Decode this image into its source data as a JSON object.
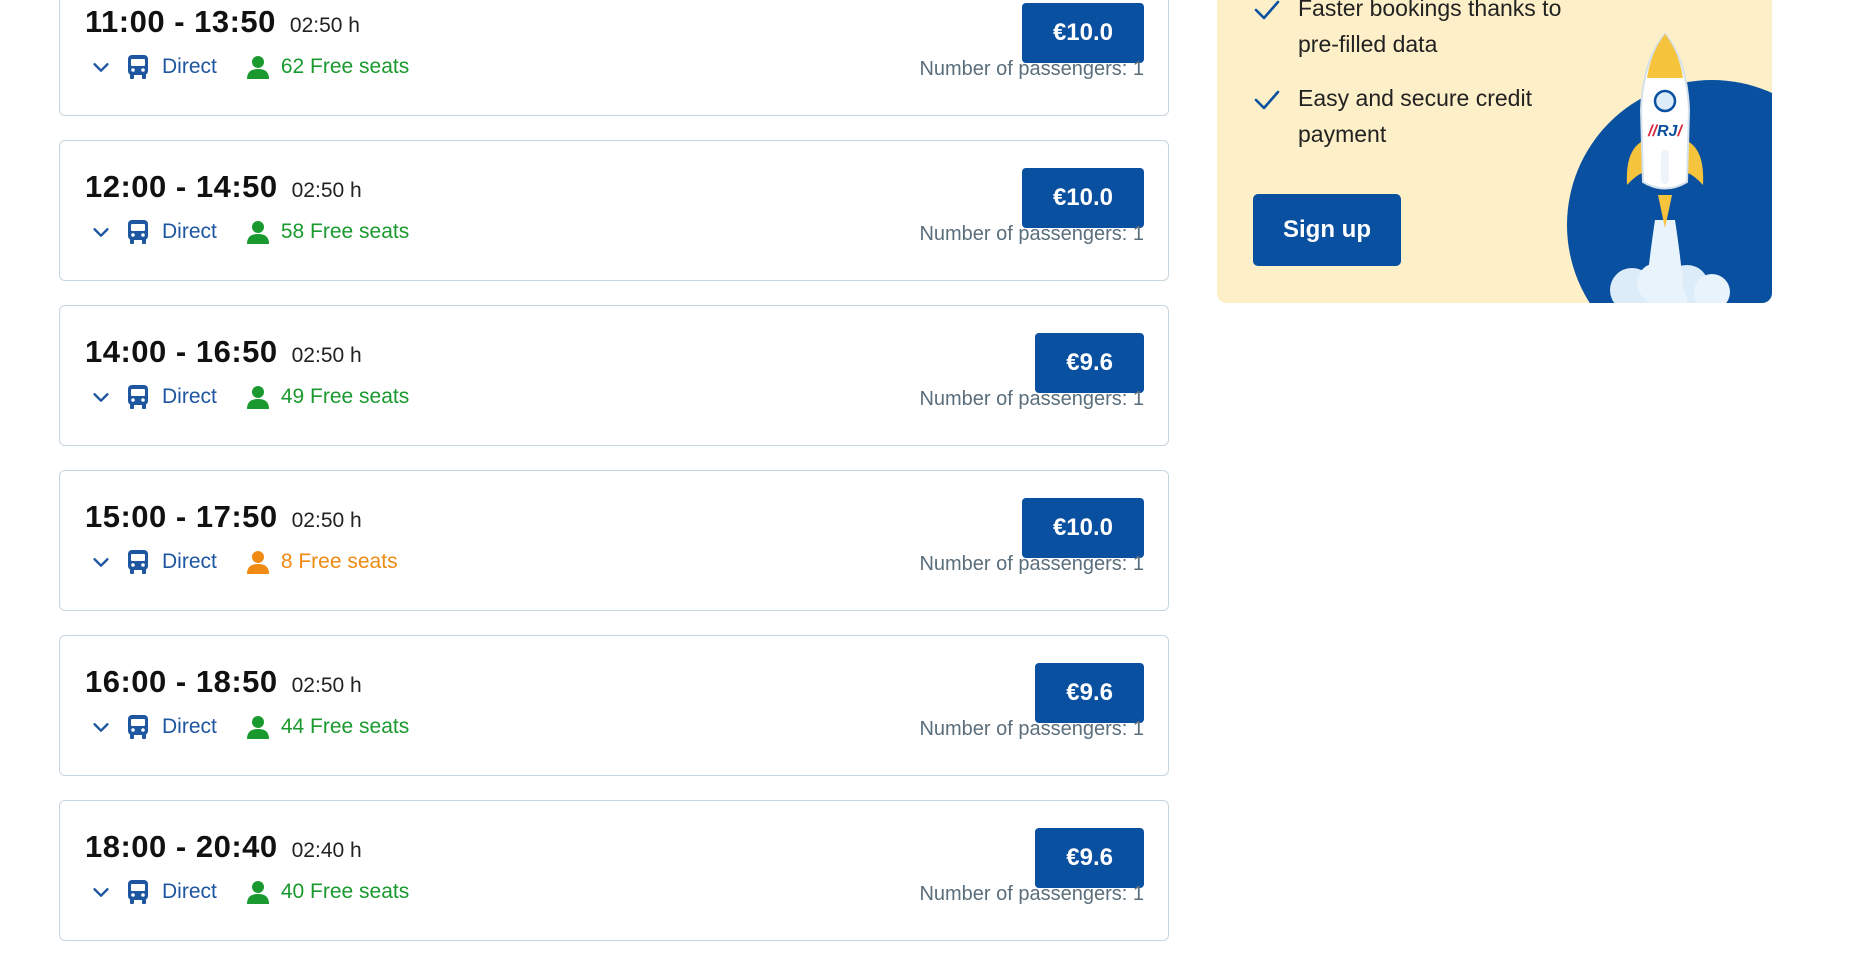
{
  "connections": [
    {
      "time": "11:00 - 13:50",
      "duration": "02:50 h",
      "type": "Direct",
      "seats": "62 Free seats",
      "seat_status": "green",
      "price": "€10.0",
      "passengers": "Number of passengers: 1"
    },
    {
      "time": "12:00 - 14:50",
      "duration": "02:50 h",
      "type": "Direct",
      "seats": "58 Free seats",
      "seat_status": "green",
      "price": "€10.0",
      "passengers": "Number of passengers: 1"
    },
    {
      "time": "14:00 - 16:50",
      "duration": "02:50 h",
      "type": "Direct",
      "seats": "49 Free seats",
      "seat_status": "green",
      "price": "€9.6",
      "passengers": "Number of passengers: 1"
    },
    {
      "time": "15:00 - 17:50",
      "duration": "02:50 h",
      "type": "Direct",
      "seats": "8 Free seats",
      "seat_status": "orange",
      "price": "€10.0",
      "passengers": "Number of passengers: 1"
    },
    {
      "time": "16:00 - 18:50",
      "duration": "02:50 h",
      "type": "Direct",
      "seats": "44 Free seats",
      "seat_status": "green",
      "price": "€9.6",
      "passengers": "Number of passengers: 1"
    },
    {
      "time": "18:00 - 20:40",
      "duration": "02:40 h",
      "type": "Direct",
      "seats": "40 Free seats",
      "seat_status": "green",
      "price": "€9.6",
      "passengers": "Number of passengers: 1"
    }
  ],
  "promo": {
    "benefits": [
      "Faster bookings thanks to pre-filled data",
      "Easy and secure credit payment"
    ],
    "signup_label": "Sign up",
    "logo_text": "RJ"
  },
  "colors": {
    "brand_blue": "#0a50a0",
    "link_blue": "#1e56a0",
    "seats_green": "#1a9a2e",
    "seats_orange": "#ef8a12",
    "promo_bg": "#fdefc8",
    "rocket_yellow": "#f6c33c",
    "logo_red": "#d8263c"
  },
  "icons": {
    "expand": "chevron-down-icon",
    "vehicle": "bus-icon",
    "seats": "person-icon",
    "benefit": "check-icon"
  }
}
